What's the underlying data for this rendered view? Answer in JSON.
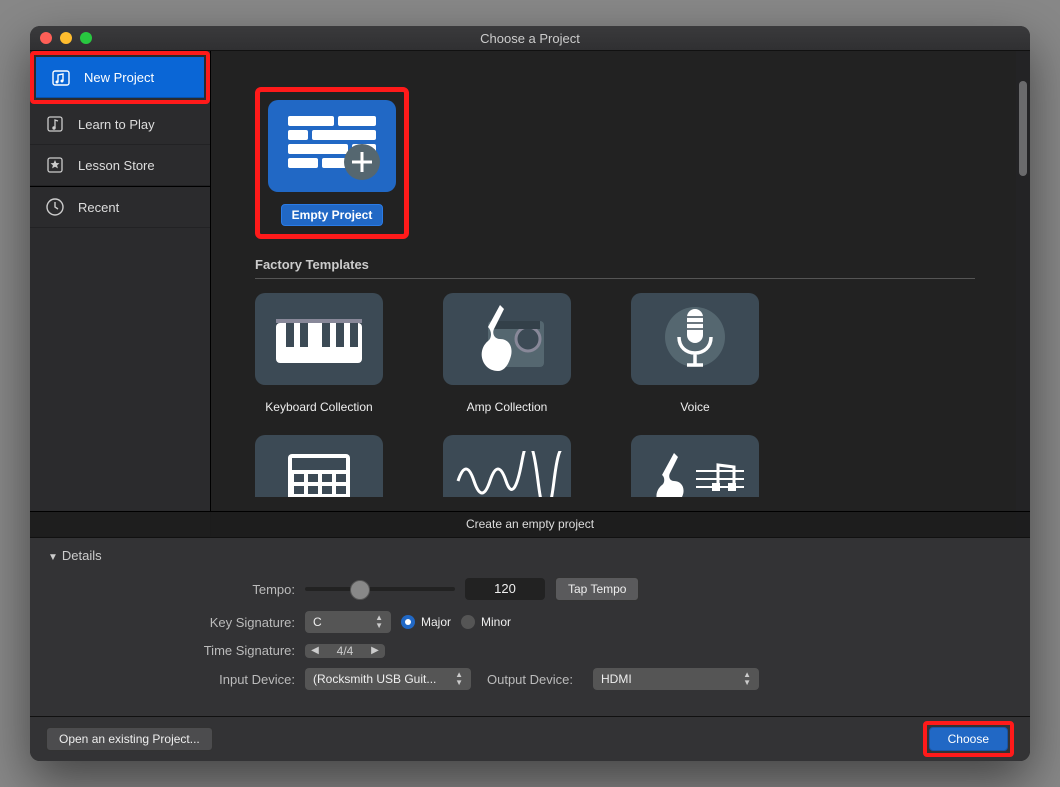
{
  "window": {
    "title": "Choose a Project"
  },
  "sidebar": {
    "items": [
      {
        "label": "New Project",
        "active": true
      },
      {
        "label": "Learn to Play",
        "active": false
      },
      {
        "label": "Lesson Store",
        "active": false
      },
      {
        "label": "Recent",
        "active": false
      }
    ]
  },
  "templates": {
    "empty": {
      "label": "Empty Project"
    },
    "section_title": "Factory Templates",
    "factory": [
      {
        "label": "Keyboard Collection"
      },
      {
        "label": "Amp Collection"
      },
      {
        "label": "Voice"
      }
    ]
  },
  "hint": "Create an empty project",
  "details": {
    "header": "Details",
    "tempo": {
      "label": "Tempo:",
      "value": "120",
      "tap": "Tap Tempo"
    },
    "key": {
      "label": "Key Signature:",
      "value": "C",
      "major": "Major",
      "minor": "Minor"
    },
    "time": {
      "label": "Time Signature:",
      "value": "4/4"
    },
    "input": {
      "label": "Input Device:",
      "value": "(Rocksmith USB Guit..."
    },
    "output": {
      "label": "Output Device:",
      "value": "HDMI"
    }
  },
  "footer": {
    "open": "Open an existing Project...",
    "choose": "Choose"
  }
}
